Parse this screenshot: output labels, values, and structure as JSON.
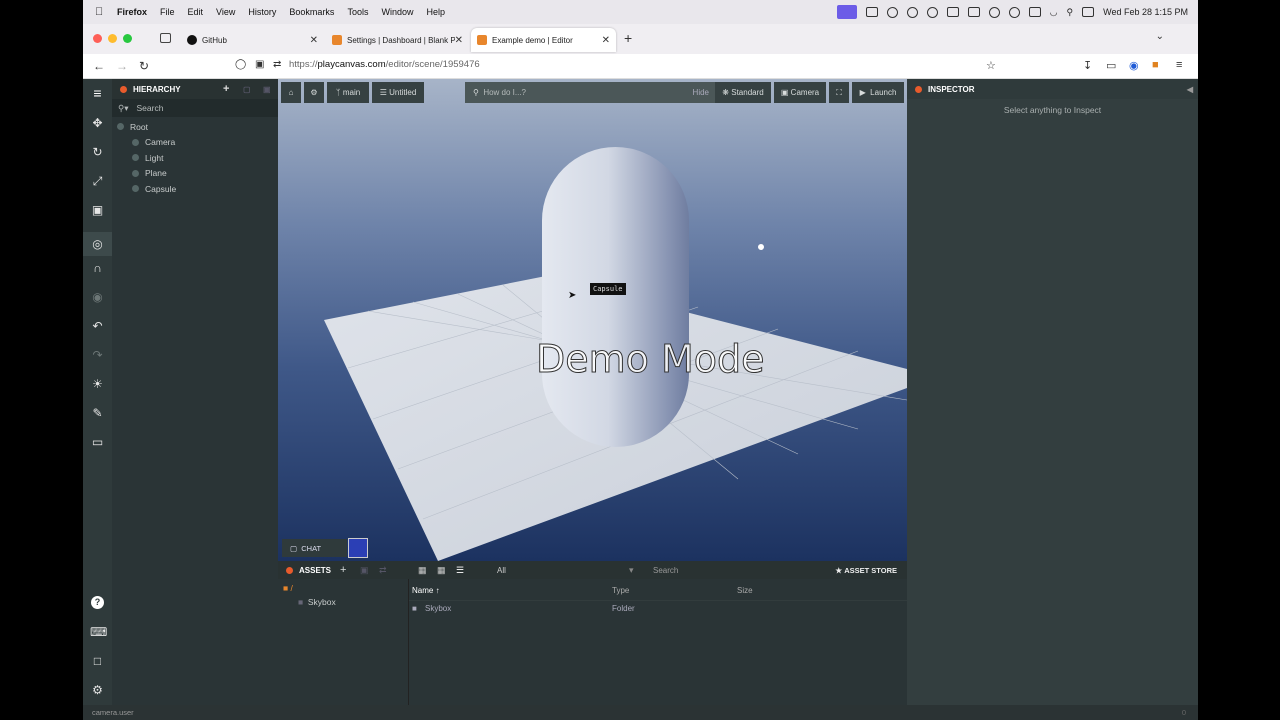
{
  "menubar": {
    "app": "Firefox",
    "items": [
      "File",
      "Edit",
      "View",
      "History",
      "Bookmarks",
      "Tools",
      "Window",
      "Help"
    ],
    "clock": "Wed Feb 28  1:15 PM"
  },
  "tabs": [
    {
      "title": "GitHub"
    },
    {
      "title": "Settings | Dashboard | Blank Pr..."
    },
    {
      "title": "Example demo | Editor"
    }
  ],
  "url": {
    "prefix": "https://",
    "host": "playcanvas.com",
    "path": "/editor/scene/1959476"
  },
  "hierarchy": {
    "title": "HIERARCHY",
    "search_placeholder": "Search",
    "tree": [
      "Root",
      "Camera",
      "Light",
      "Plane",
      "Capsule"
    ]
  },
  "toolbar": {
    "branch": "main",
    "scene": "Untitled",
    "help_placeholder": "How do I...?",
    "hide": "Hide",
    "quality": "Standard",
    "camera": "Camera",
    "launch": "Launch"
  },
  "viewport": {
    "overlay": "Demo Mode",
    "tooltip": "Capsule",
    "chat": "CHAT"
  },
  "assets": {
    "title": "ASSETS",
    "filter": "All",
    "search_placeholder": "Search",
    "store": "ASSET STORE",
    "folder_root": "/",
    "folders": [
      "Skybox"
    ],
    "columns": [
      "Name",
      "Type",
      "Size"
    ],
    "rows": [
      {
        "name": "Skybox",
        "type": "Folder",
        "size": ""
      }
    ]
  },
  "inspector": {
    "title": "INSPECTOR",
    "empty": "Select anything to Inspect"
  },
  "status": {
    "text": "camera.user",
    "right": "0"
  }
}
